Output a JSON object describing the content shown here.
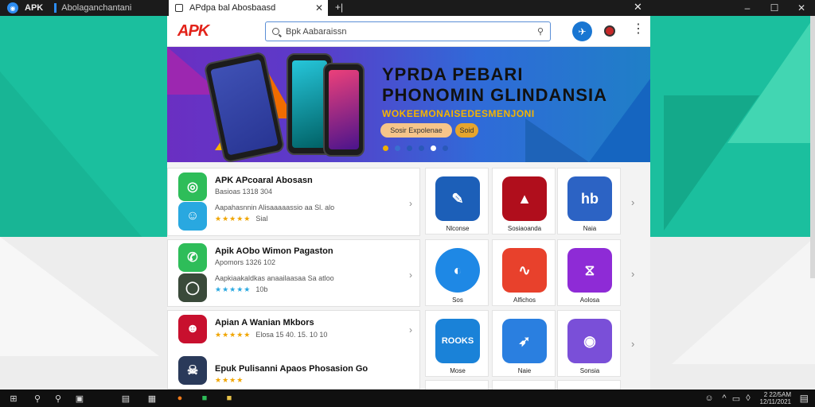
{
  "titlebar": {
    "app_name": "APK",
    "window_title": "Abolaganchantani",
    "tab_label": "APdpa bal Abosbaasd",
    "controls": [
      "–",
      "☐",
      "✕"
    ]
  },
  "toolbar": {
    "logo": "APK",
    "search_text": "Bpk Aabaraissn",
    "avatar_glyph": "✈"
  },
  "banner": {
    "line1": "YPRDA PEBARI",
    "line2": "PHONOMIN GLINDANSIA",
    "line3": "WOKEEMONAISEDESMENJONI",
    "button1": "Sosir Expolenae",
    "button2": "Soid",
    "dot_colors": [
      "#f0b000",
      "#3a6fd0",
      "#2a58b8",
      "#2a58b8",
      "#ffffff",
      "#2a58b8"
    ]
  },
  "list": [
    {
      "title": "APK APcoaral Abosasn",
      "sub": "Basioas 1318 304",
      "color": "#2ebd59",
      "glyph": "◎"
    },
    {
      "title": "",
      "sub": "Aapahasnnin Alisaaaaassio aa Sl. alo",
      "stars": "★★★★★",
      "meta": "Sial",
      "color": "#29a8e0",
      "glyph": "☺"
    },
    {
      "title": "Apik AObo Wimon Pagaston",
      "sub": "Apomors 1326 102",
      "color": "#2ebd59",
      "glyph": "✆"
    },
    {
      "title": "",
      "sub": "Aapkiaakaldkas anaailaasaa Sa atloo",
      "stars": "★★★★★",
      "meta": "10b",
      "color": "#3a4a3a",
      "glyph": "◯"
    },
    {
      "title": "Apian A Wanian Mkbors",
      "sub": "",
      "stars": "★★★★★",
      "meta": "Elosa 15 40. 15. 10 10",
      "color": "#c8102e",
      "glyph": "☻"
    },
    {
      "title": "Epuk Pulisanni Apaos Phosasion Go",
      "sub": "",
      "stars": "★★★★",
      "meta": "",
      "color": "#2a3a5a",
      "glyph": "☠"
    }
  ],
  "grid": [
    {
      "label": "Nlconse",
      "color": "#1c5fb8",
      "glyph": "✎"
    },
    {
      "label": "Sosiaoanda",
      "color": "#b00e1c",
      "glyph": "▲"
    },
    {
      "label": "Naia",
      "color": "#2c63c4",
      "glyph": "hb"
    },
    {
      "label": "Sos",
      "color": "#1e88e5",
      "glyph": "◐"
    },
    {
      "label": "Alfichos",
      "color": "#e8412c",
      "glyph": "∿"
    },
    {
      "label": "Aolosa",
      "color": "#8e2bd6",
      "glyph": "⧖"
    },
    {
      "label": "Mose",
      "color": "#1a82d8",
      "glyph": "ROOKS"
    },
    {
      "label": "Naie",
      "color": "#2a7fe0",
      "glyph": "➶"
    },
    {
      "label": "Sonsia",
      "color": "#7a4fd8",
      "glyph": "◉"
    }
  ],
  "taskbar": {
    "clock_line1": "2 22/5AM",
    "clock_line2": "12/11/2021"
  }
}
